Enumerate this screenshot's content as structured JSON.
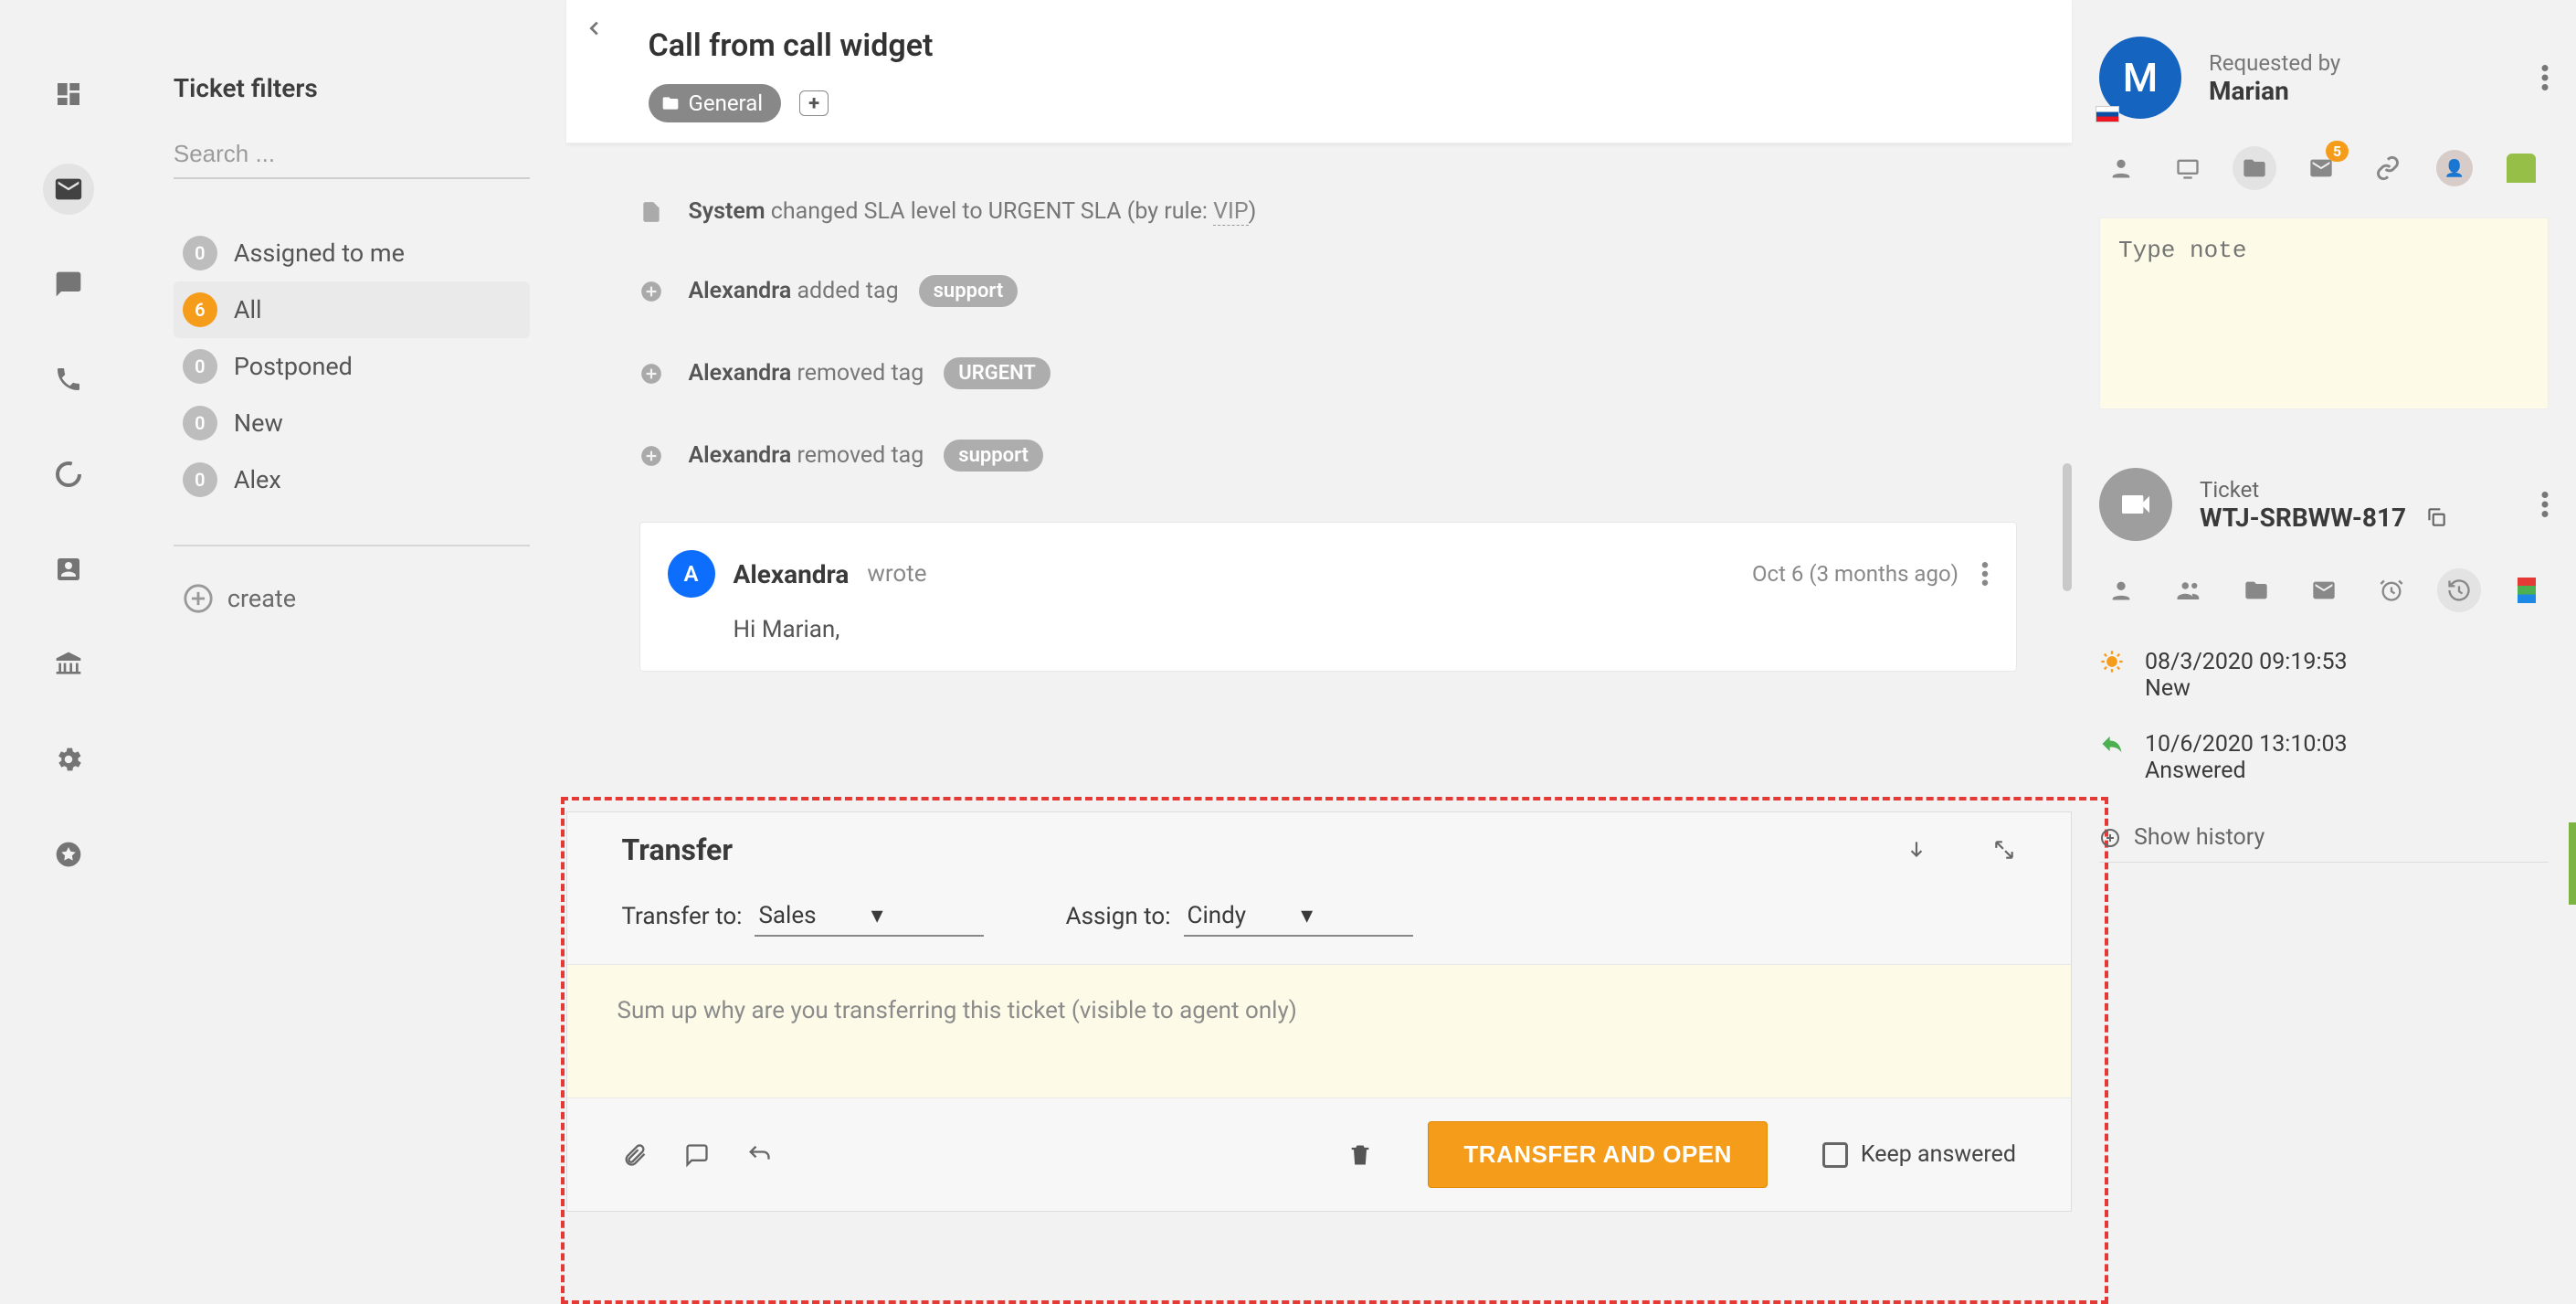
{
  "sidebar": {
    "title": "Ticket filters",
    "search_placeholder": "Search ...",
    "filters": [
      {
        "count": "0",
        "label": "Assigned to me",
        "active": false
      },
      {
        "count": "6",
        "label": "All",
        "active": true
      },
      {
        "count": "0",
        "label": "Postponed",
        "active": false
      },
      {
        "count": "0",
        "label": "New",
        "active": false
      },
      {
        "count": "0",
        "label": "Alex",
        "active": false
      }
    ],
    "create_label": "create"
  },
  "ticket": {
    "title": "Call from call widget",
    "tag": "General",
    "back": "‹"
  },
  "timeline": {
    "sla": {
      "actor": "System",
      "text_before": " changed SLA level to URGENT SLA (by rule: ",
      "link": "VIP",
      "text_after": ")"
    },
    "add_tag": {
      "actor": "Alexandra",
      "text": " added tag ",
      "tag": "support"
    },
    "rem_tag1": {
      "actor": "Alexandra",
      "text": " removed tag ",
      "tag": "URGENT"
    },
    "rem_tag2": {
      "actor": "Alexandra",
      "text": " removed tag ",
      "tag": "support"
    },
    "message": {
      "avatar": "A",
      "name": "Alexandra",
      "sub": "wrote",
      "time": "Oct 6 (3 months ago)",
      "body": "Hi Marian,"
    }
  },
  "transfer": {
    "title": "Transfer",
    "to_label": "Transfer to:",
    "to_value": "Sales",
    "assign_label": "Assign to:",
    "assign_value": "Cindy",
    "note_placeholder": "Sum up why are you transferring this ticket (visible to agent only)",
    "button": "TRANSFER AND OPEN",
    "keep": "Keep answered"
  },
  "right": {
    "requested_by_label": "Requested by",
    "requester_name": "Marian",
    "requester_avatar": "M",
    "mail_badge": "5",
    "note_placeholder": "Type note",
    "ticket_label": "Ticket",
    "ticket_id": "WTJ-SRBWW-817",
    "history": [
      {
        "time": "08/3/2020 09:19:53",
        "status": "New"
      },
      {
        "time": "10/6/2020 13:10:03",
        "status": "Answered"
      }
    ],
    "show_history": "Show history"
  }
}
